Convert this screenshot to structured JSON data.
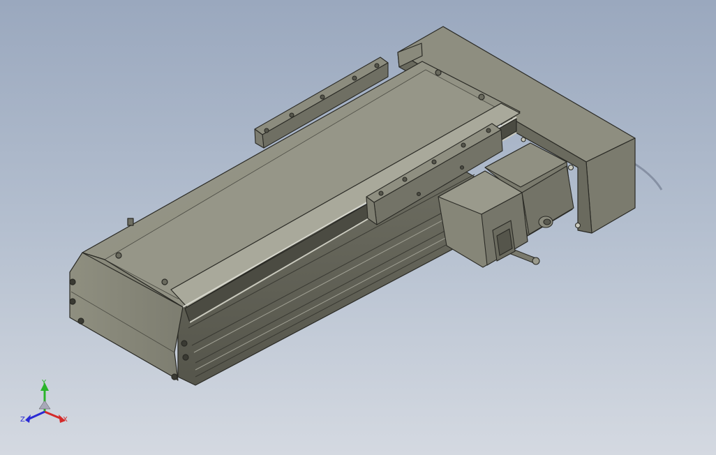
{
  "viewport": {
    "background_top": "#9aa8be",
    "background_bottom": "#d4d9e1"
  },
  "model": {
    "body_color": "#8b8b7b",
    "edge_color": "#2a2a25"
  },
  "triad": {
    "x_label": "X",
    "y_label": "Y",
    "z_label": "Z",
    "x_color": "#d42a2a",
    "y_color": "#2ab42a",
    "z_color": "#2a2ad4"
  }
}
